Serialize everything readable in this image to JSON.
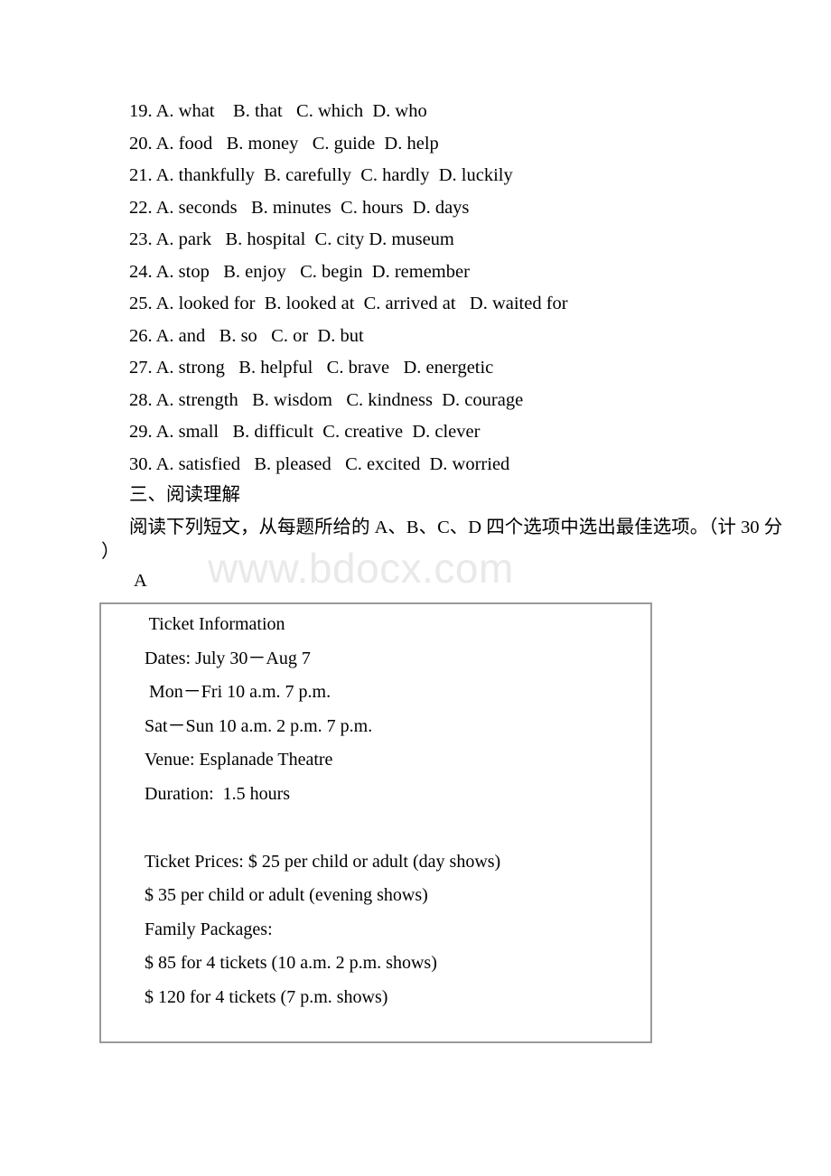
{
  "page": {
    "watermark": "www.bdocx.com",
    "background_color": "#ffffff",
    "text_color": "#000000",
    "box_border_color": "#9a9a9a",
    "watermark_color": "#e9e9e9"
  },
  "cloze_questions": [
    "19. A. what    B. that   C. which  D. who",
    "20. A. food   B. money   C. guide  D. help",
    "21. A. thankfully  B. carefully  C. hardly  D. luckily",
    "22. A. seconds   B. minutes  C. hours  D. days",
    "23. A. park   B. hospital  C. city D. museum",
    "24. A. stop   B. enjoy   C. begin  D. remember",
    "25. A. looked for  B. looked at  C. arrived at   D. waited for",
    "26. A. and   B. so   C. or  D. but",
    "27. A. strong   B. helpful   C. brave   D. energetic",
    "28. A. strength   B. wisdom   C. kindness  D. courage",
    "29. A. small   B. difficult  C. creative  D. clever",
    "30. A. satisfied   B. pleased   C. excited  D. worried"
  ],
  "reading_section": {
    "heading": "三、阅读理解",
    "instruction": "阅读下列短文，从每题所给的 A、B、C、D 四个选项中选出最佳选项。（计 30 分",
    "instruction_tail": "）",
    "passage_label": "A"
  },
  "ticket_info": {
    "lines": [
      " Ticket Information",
      "Dates: July 30－Aug 7",
      " Mon－Fri 10 a.m. 7 p.m.",
      "Sat－Sun 10 a.m. 2 p.m. 7 p.m.",
      "Venue: Esplanade Theatre",
      "Duration:  1.5 hours",
      "",
      "Ticket Prices: $ 25 per child or adult (day shows)",
      "$ 35 per child or adult (evening shows)",
      "Family Packages:",
      "$ 85 for 4 tickets (10 a.m. 2 p.m. shows)",
      "$ 120 for 4 tickets (7 p.m. shows)"
    ]
  }
}
